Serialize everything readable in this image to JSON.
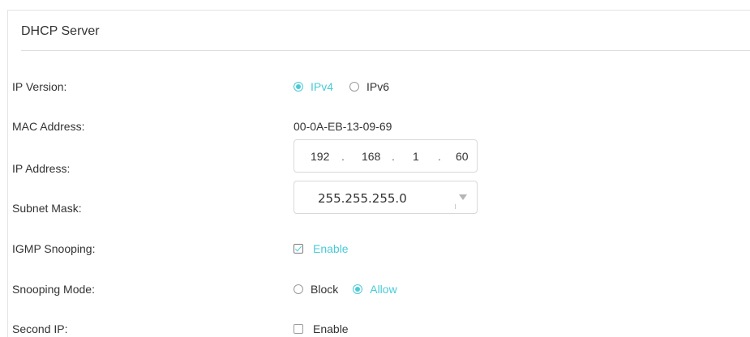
{
  "section": {
    "title": "DHCP Server"
  },
  "rows": {
    "ip_version": {
      "label": "IP Version:",
      "options": [
        "IPv4",
        "IPv6"
      ],
      "selected": "IPv4"
    },
    "mac_address": {
      "label": "MAC Address:",
      "value": "00-0A-EB-13-09-69"
    },
    "ip_address": {
      "label": "IP Address:",
      "octets": [
        "192",
        "168",
        "1",
        "60"
      ],
      "separator": "."
    },
    "subnet_mask": {
      "label": "Subnet Mask:",
      "value": "255.255.255.0"
    },
    "igmp_snooping": {
      "label": "IGMP Snooping:",
      "option_label": "Enable",
      "checked": true
    },
    "snooping_mode": {
      "label": "Snooping Mode:",
      "options": [
        "Block",
        "Allow"
      ],
      "selected": "Allow"
    },
    "second_ip": {
      "label": "Second IP:",
      "option_label": "Enable",
      "checked": false
    }
  },
  "colors": {
    "accent": "#4acbd6",
    "text": "#333333",
    "border": "#d8d8d8"
  }
}
